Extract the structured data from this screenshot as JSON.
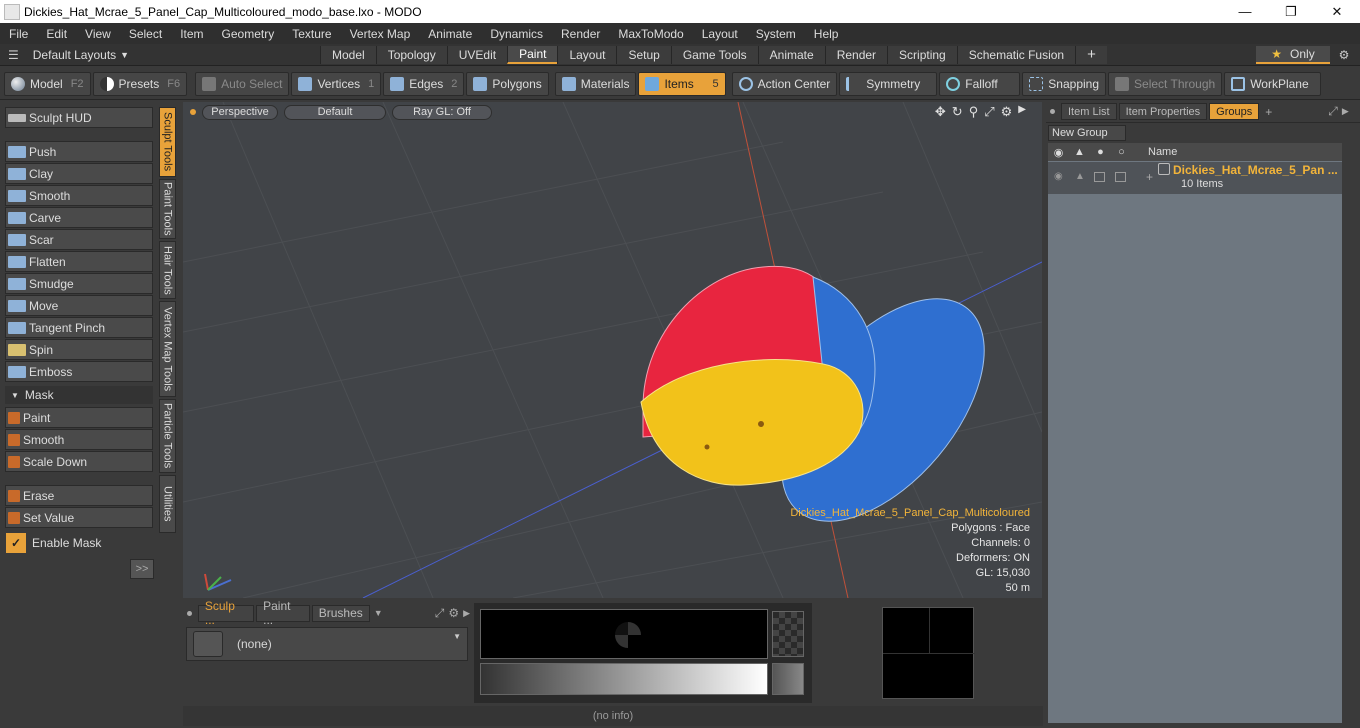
{
  "window": {
    "title": "Dickies_Hat_Mcrae_5_Panel_Cap_Multicoloured_modo_base.lxo - MODO"
  },
  "menu": [
    "File",
    "Edit",
    "View",
    "Select",
    "Item",
    "Geometry",
    "Texture",
    "Vertex Map",
    "Animate",
    "Dynamics",
    "Render",
    "MaxToModo",
    "Layout",
    "System",
    "Help"
  ],
  "layouts": {
    "default_label": "Default Layouts",
    "tabs": [
      "Model",
      "Topology",
      "UVEdit",
      "Paint",
      "Layout",
      "Setup",
      "Game Tools",
      "Animate",
      "Render",
      "Scripting",
      "Schematic Fusion"
    ],
    "active": "Paint",
    "only_label": "Only"
  },
  "toolbar": {
    "model": "Model",
    "model_key": "F2",
    "presets": "Presets",
    "presets_key": "F6",
    "auto_select": "Auto Select",
    "vertices": "Vertices",
    "vertices_key": "1",
    "edges": "Edges",
    "edges_key": "2",
    "polygons": "Polygons",
    "materials": "Materials",
    "items": "Items",
    "items_key": "5",
    "action_center": "Action Center",
    "symmetry": "Symmetry",
    "falloff": "Falloff",
    "snapping": "Snapping",
    "select_through": "Select Through",
    "workplane": "WorkPlane"
  },
  "sculpt": {
    "hud": "Sculpt HUD",
    "tools": [
      "Push",
      "Clay",
      "Smooth",
      "Carve",
      "Scar",
      "Flatten",
      "Smudge",
      "Move",
      "Tangent Pinch",
      "Spin",
      "Emboss"
    ],
    "mask_header": "Mask",
    "mask_tools": [
      "Paint",
      "Smooth",
      "Scale Down"
    ],
    "mask_tools2": [
      "Erase",
      "Set Value"
    ],
    "enable_mask": "Enable Mask",
    "expand": ">>",
    "vtabs": [
      "Sculpt Tools",
      "Paint Tools",
      "Hair Tools",
      "Vertex Map Tools",
      "Particle Tools",
      "Utilities"
    ]
  },
  "viewport": {
    "view": "Perspective",
    "shading": "Default",
    "render": "Ray GL: Off",
    "info": {
      "name": "Dickies_Hat_Mcrae_5_Panel_Cap_Multicoloured",
      "polygons": "Polygons : Face",
      "channels": "Channels: 0",
      "deformers": "Deformers: ON",
      "gl": "GL: 15,030",
      "scale": "50 m"
    }
  },
  "bottom": {
    "tabs": [
      "Sculp ...",
      "Paint ...",
      "Brushes"
    ],
    "brush_value": "(none)"
  },
  "status": "(no info)",
  "right": {
    "tabs": [
      "Item List",
      "Item Properties",
      "Groups"
    ],
    "new_group": "New Group",
    "col_name": "Name",
    "group_name": "Dickies_Hat_Mcrae_5_Pan ...",
    "group_count": "10 Items"
  },
  "colors": {
    "accent": "#e8a23a",
    "red": "#e8253f",
    "blue": "#2f6fd0",
    "yellow": "#f2c21a"
  }
}
